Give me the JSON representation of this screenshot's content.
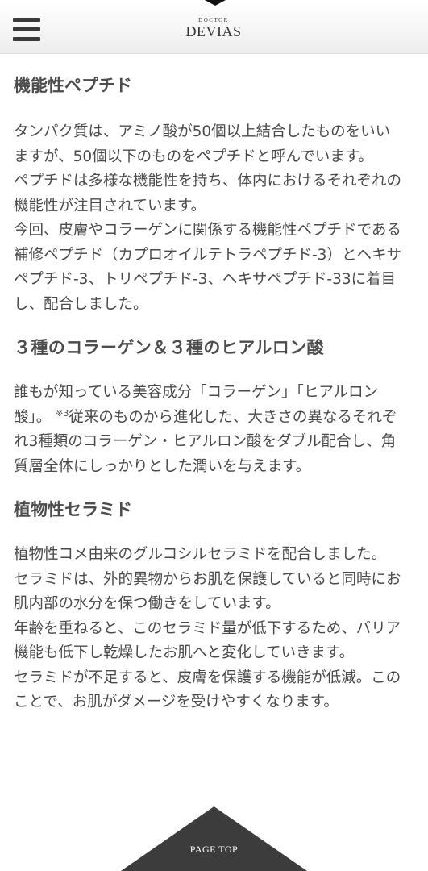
{
  "header": {
    "menu_icon": "hamburger-menu-icon",
    "logo_small": "DOCTOR",
    "logo_main": "DEVIAS"
  },
  "sections": [
    {
      "title": "機能性ペプチド",
      "paragraph": "タンパク質は、アミノ酸が50個以上結合したものをいいますが、50個以下のものをペプチドと呼んでいます。\nペプチドは多様な機能性を持ち、体内におけるそれぞれの機能性が注目されています。\n今回、皮膚やコラーゲンに関係する機能性ペプチドである補修ペプチド（カプロオイルテトラペプチド-3）とヘキサペプチド-3、トリペプチド-3、ヘキサペプチド-33に着目し、配合しました。"
    },
    {
      "title": "３種のコラーゲン＆３種のヒアルロン酸",
      "paragraph_before": "誰もが知っている美容成分「コラーゲン」「ヒアルロン酸」。 ",
      "note": "※3",
      "paragraph_after": "従来のものから進化した、大きさの異なるそれぞれ3種類のコラーゲン・ヒアルロン酸をダブル配合し、角質層全体にしっかりとした潤いを与えます。"
    },
    {
      "title": "植物性セラミド",
      "paragraph": "植物性コメ由来のグルコシルセラミドを配合しました。\nセラミドは、外的異物からお肌を保護していると同時にお肌内部の水分を保つ働きをしています。\n年齢を重ねると、このセラミド量が低下するため、バリア機能も低下し乾燥したお肌へと変化していきます。\nセラミドが不足すると、皮膚を保護する機能が低減。このことで、お肌がダメージを受けやすくなります。"
    }
  ],
  "page_top": {
    "label": "PAGE TOP"
  },
  "colors": {
    "text": "#4a4a4a",
    "page_top_bg": "#3c3c3c"
  }
}
